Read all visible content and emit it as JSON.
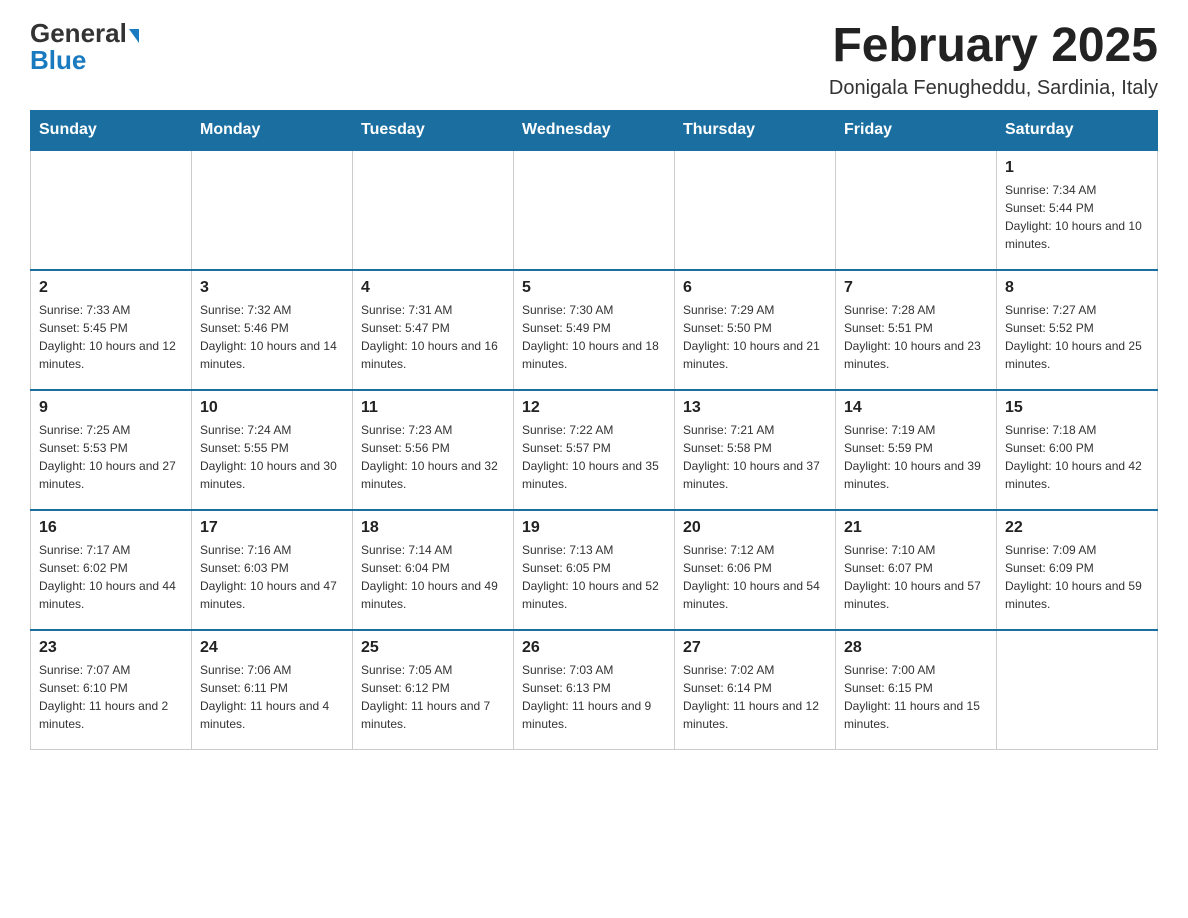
{
  "header": {
    "logo_general": "General",
    "logo_blue": "Blue",
    "month_title": "February 2025",
    "location": "Donigala Fenugheddu, Sardinia, Italy"
  },
  "weekdays": [
    "Sunday",
    "Monday",
    "Tuesday",
    "Wednesday",
    "Thursday",
    "Friday",
    "Saturday"
  ],
  "weeks": [
    [
      {
        "day": "",
        "info": ""
      },
      {
        "day": "",
        "info": ""
      },
      {
        "day": "",
        "info": ""
      },
      {
        "day": "",
        "info": ""
      },
      {
        "day": "",
        "info": ""
      },
      {
        "day": "",
        "info": ""
      },
      {
        "day": "1",
        "info": "Sunrise: 7:34 AM\nSunset: 5:44 PM\nDaylight: 10 hours and 10 minutes."
      }
    ],
    [
      {
        "day": "2",
        "info": "Sunrise: 7:33 AM\nSunset: 5:45 PM\nDaylight: 10 hours and 12 minutes."
      },
      {
        "day": "3",
        "info": "Sunrise: 7:32 AM\nSunset: 5:46 PM\nDaylight: 10 hours and 14 minutes."
      },
      {
        "day": "4",
        "info": "Sunrise: 7:31 AM\nSunset: 5:47 PM\nDaylight: 10 hours and 16 minutes."
      },
      {
        "day": "5",
        "info": "Sunrise: 7:30 AM\nSunset: 5:49 PM\nDaylight: 10 hours and 18 minutes."
      },
      {
        "day": "6",
        "info": "Sunrise: 7:29 AM\nSunset: 5:50 PM\nDaylight: 10 hours and 21 minutes."
      },
      {
        "day": "7",
        "info": "Sunrise: 7:28 AM\nSunset: 5:51 PM\nDaylight: 10 hours and 23 minutes."
      },
      {
        "day": "8",
        "info": "Sunrise: 7:27 AM\nSunset: 5:52 PM\nDaylight: 10 hours and 25 minutes."
      }
    ],
    [
      {
        "day": "9",
        "info": "Sunrise: 7:25 AM\nSunset: 5:53 PM\nDaylight: 10 hours and 27 minutes."
      },
      {
        "day": "10",
        "info": "Sunrise: 7:24 AM\nSunset: 5:55 PM\nDaylight: 10 hours and 30 minutes."
      },
      {
        "day": "11",
        "info": "Sunrise: 7:23 AM\nSunset: 5:56 PM\nDaylight: 10 hours and 32 minutes."
      },
      {
        "day": "12",
        "info": "Sunrise: 7:22 AM\nSunset: 5:57 PM\nDaylight: 10 hours and 35 minutes."
      },
      {
        "day": "13",
        "info": "Sunrise: 7:21 AM\nSunset: 5:58 PM\nDaylight: 10 hours and 37 minutes."
      },
      {
        "day": "14",
        "info": "Sunrise: 7:19 AM\nSunset: 5:59 PM\nDaylight: 10 hours and 39 minutes."
      },
      {
        "day": "15",
        "info": "Sunrise: 7:18 AM\nSunset: 6:00 PM\nDaylight: 10 hours and 42 minutes."
      }
    ],
    [
      {
        "day": "16",
        "info": "Sunrise: 7:17 AM\nSunset: 6:02 PM\nDaylight: 10 hours and 44 minutes."
      },
      {
        "day": "17",
        "info": "Sunrise: 7:16 AM\nSunset: 6:03 PM\nDaylight: 10 hours and 47 minutes."
      },
      {
        "day": "18",
        "info": "Sunrise: 7:14 AM\nSunset: 6:04 PM\nDaylight: 10 hours and 49 minutes."
      },
      {
        "day": "19",
        "info": "Sunrise: 7:13 AM\nSunset: 6:05 PM\nDaylight: 10 hours and 52 minutes."
      },
      {
        "day": "20",
        "info": "Sunrise: 7:12 AM\nSunset: 6:06 PM\nDaylight: 10 hours and 54 minutes."
      },
      {
        "day": "21",
        "info": "Sunrise: 7:10 AM\nSunset: 6:07 PM\nDaylight: 10 hours and 57 minutes."
      },
      {
        "day": "22",
        "info": "Sunrise: 7:09 AM\nSunset: 6:09 PM\nDaylight: 10 hours and 59 minutes."
      }
    ],
    [
      {
        "day": "23",
        "info": "Sunrise: 7:07 AM\nSunset: 6:10 PM\nDaylight: 11 hours and 2 minutes."
      },
      {
        "day": "24",
        "info": "Sunrise: 7:06 AM\nSunset: 6:11 PM\nDaylight: 11 hours and 4 minutes."
      },
      {
        "day": "25",
        "info": "Sunrise: 7:05 AM\nSunset: 6:12 PM\nDaylight: 11 hours and 7 minutes."
      },
      {
        "day": "26",
        "info": "Sunrise: 7:03 AM\nSunset: 6:13 PM\nDaylight: 11 hours and 9 minutes."
      },
      {
        "day": "27",
        "info": "Sunrise: 7:02 AM\nSunset: 6:14 PM\nDaylight: 11 hours and 12 minutes."
      },
      {
        "day": "28",
        "info": "Sunrise: 7:00 AM\nSunset: 6:15 PM\nDaylight: 11 hours and 15 minutes."
      },
      {
        "day": "",
        "info": ""
      }
    ]
  ]
}
